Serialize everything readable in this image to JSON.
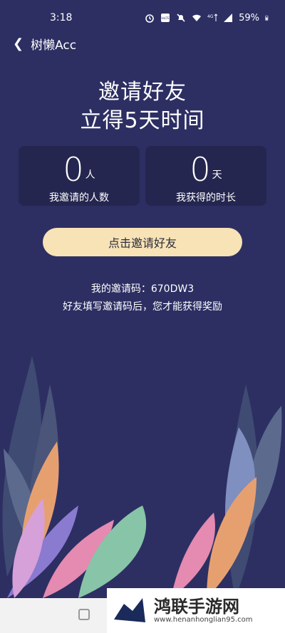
{
  "status_bar": {
    "time": "3:18",
    "battery": "59%",
    "icons": [
      "alarm-icon",
      "volte-icon",
      "mute-icon",
      "wifi-icon",
      "4g-icon",
      "signal-icon",
      "battery-icon"
    ],
    "volte_text": "VoLTE",
    "network_type": "4G"
  },
  "nav": {
    "title": "树懒Acc",
    "back_icon": "chevron-left-icon"
  },
  "headline": {
    "line1": "邀请好友",
    "line2": "立得5天时间"
  },
  "stats": [
    {
      "value": "0",
      "unit": "人",
      "label": "我邀请的人数"
    },
    {
      "value": "0",
      "unit": "天",
      "label": "我获得的时长"
    }
  ],
  "invite_button": {
    "label": "点击邀请好友"
  },
  "invite_code": "我的邀请码：670DW3",
  "hint": "好友填写邀请码后，您才能获得奖励",
  "watermark": {
    "text": "鸿联手游网",
    "url": "www.henanhonglian95.com"
  },
  "colors": {
    "background": "#2d2f63",
    "card": "#24264f",
    "button": "#f7e3b5"
  }
}
